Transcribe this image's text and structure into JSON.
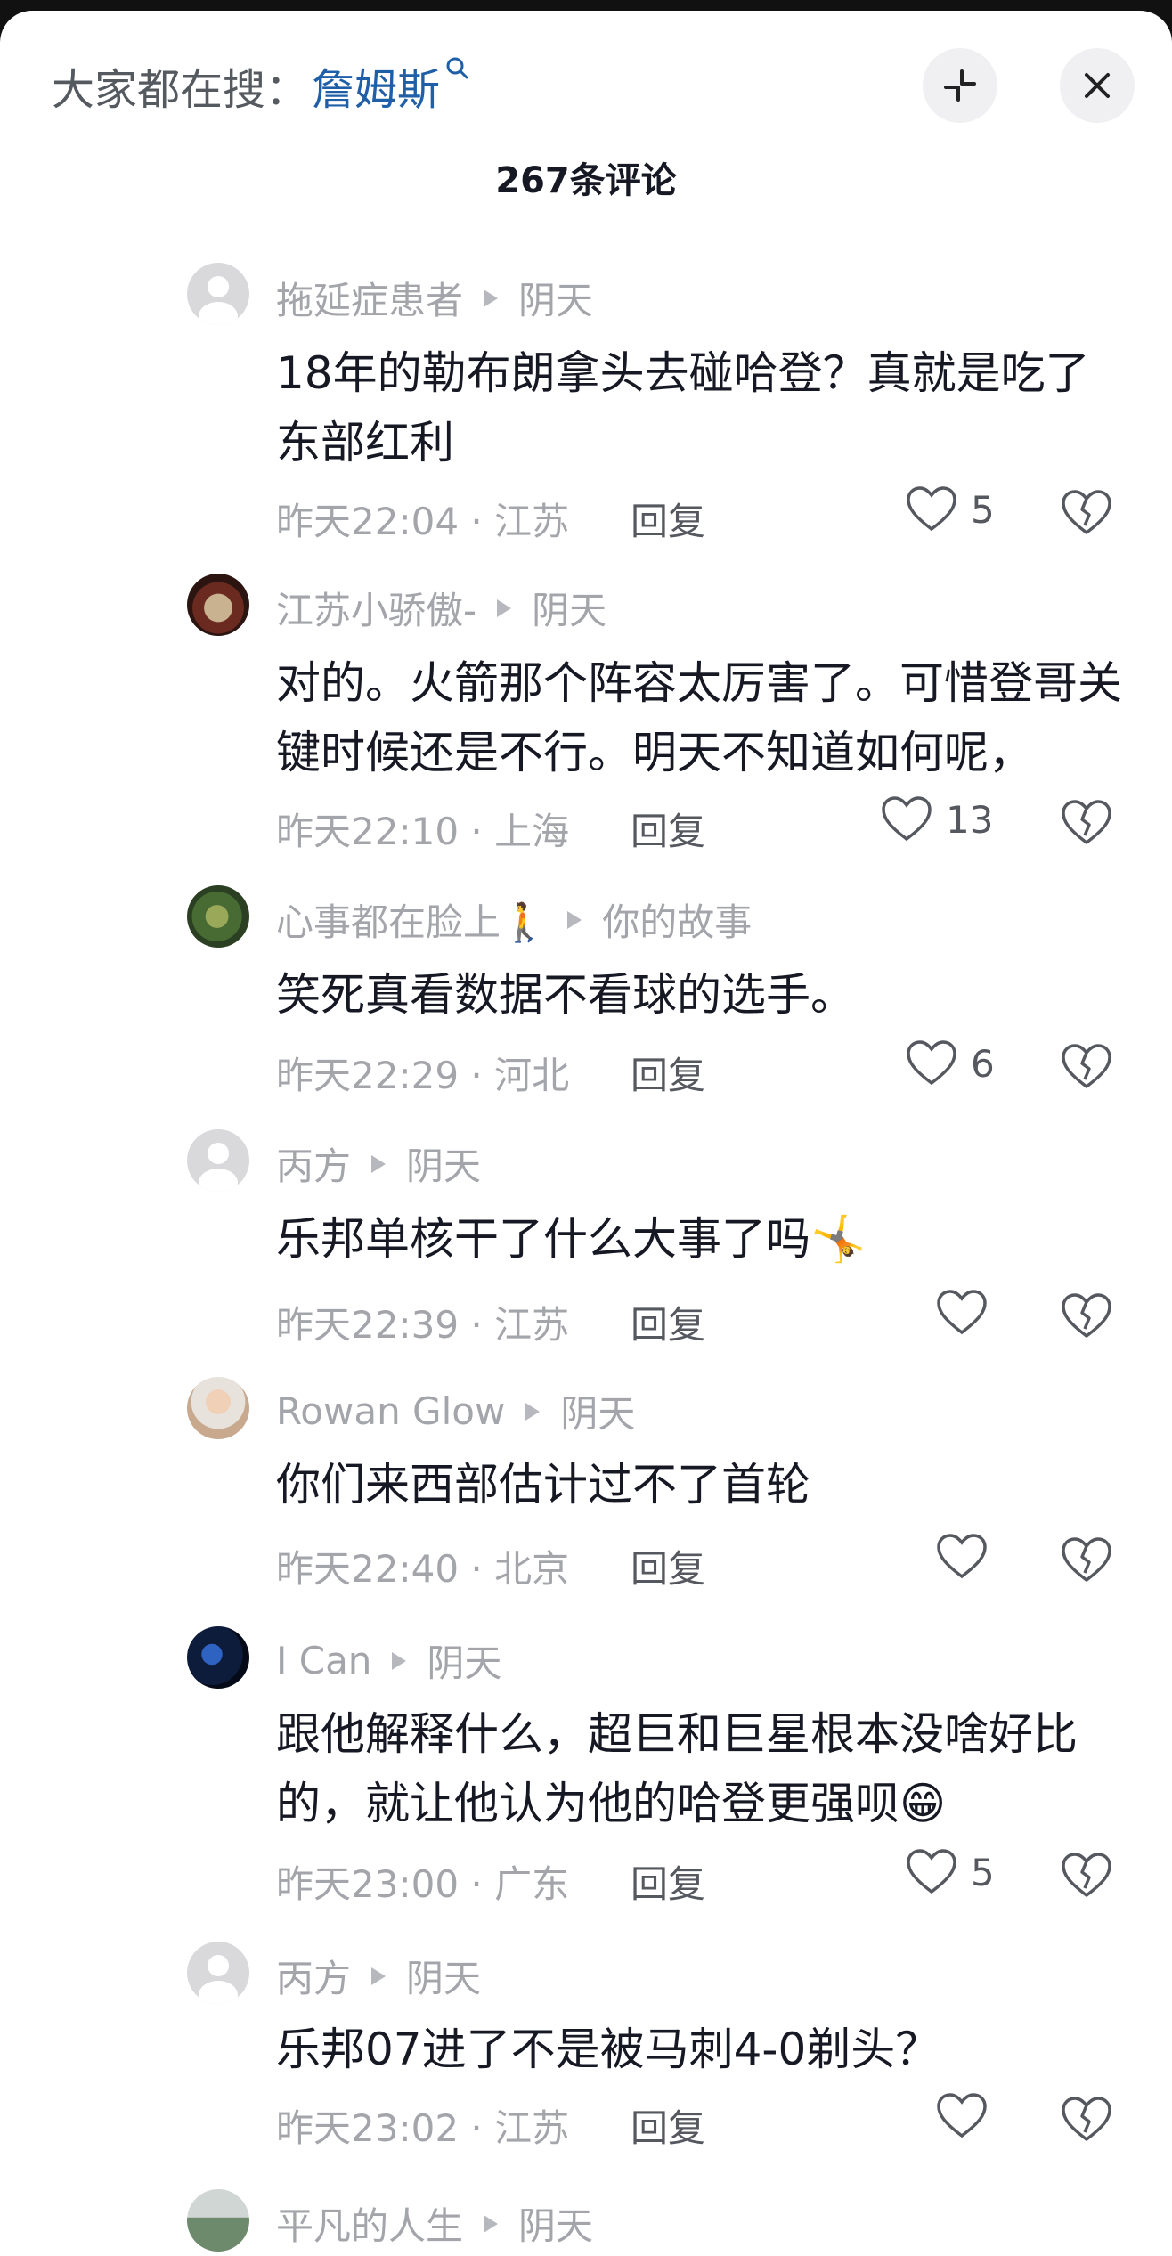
{
  "search": {
    "prefix": "大家都在搜：",
    "term": "詹姆斯"
  },
  "header": {
    "comment_count": "267条评论"
  },
  "comments": [
    {
      "user": "拖延症患者",
      "reply_to": "阴天",
      "text": "18年的勒布朗拿头去碰哈登？真就是吃了东部红利",
      "time": "昨天22:04 · 江苏",
      "reply_label": "回复",
      "likes": "5",
      "avatar": "default"
    },
    {
      "user": "江苏小骄傲-",
      "reply_to": "阴天",
      "text": "对的。火箭那个阵容太厉害了。可惜登哥关键时候还是不行。明天不知道如何呢，",
      "time": "昨天22:10 · 上海",
      "reply_label": "回复",
      "likes": "13",
      "avatar": "photo"
    },
    {
      "user": "心事都在脸上🚶",
      "reply_to": "你的故事",
      "text": "笑死真看数据不看球的选手。",
      "time": "昨天22:29 · 河北",
      "reply_label": "回复",
      "likes": "6",
      "avatar": "photo"
    },
    {
      "user": "丙方",
      "reply_to": "阴天",
      "text": "乐邦单核干了什么大事了吗🤸",
      "time": "昨天22:39 · 江苏",
      "reply_label": "回复",
      "likes": "",
      "avatar": "default"
    },
    {
      "user": "Rowan Glow",
      "reply_to": "阴天",
      "text": "你们来西部估计过不了首轮",
      "time": "昨天22:40 · 北京",
      "reply_label": "回复",
      "likes": "",
      "avatar": "photo"
    },
    {
      "user": "I Can",
      "reply_to": "阴天",
      "text": "跟他解释什么，超巨和巨星根本没啥好比的，就让他认为他的哈登更强呗😁",
      "time": "昨天23:00 · 广东",
      "reply_label": "回复",
      "likes": "5",
      "avatar": "photo"
    },
    {
      "user": "丙方",
      "reply_to": "阴天",
      "text": "乐邦07进了不是被马刺4-0剃头？",
      "time": "昨天23:02 · 江苏",
      "reply_label": "回复",
      "likes": "",
      "avatar": "default"
    },
    {
      "user": "平凡的人生",
      "reply_to": "阴天",
      "text": "",
      "time": "",
      "reply_label": "",
      "likes": "",
      "avatar": "photo"
    }
  ],
  "colors": {
    "text_primary": "#161823",
    "text_secondary": "#a3a5ab",
    "link": "#1f5fa8",
    "button_bg": "#f0f0f2"
  },
  "icons": [
    "search-icon",
    "collapse-icon",
    "close-icon",
    "play-triangle-icon",
    "heart-icon",
    "dislike-heart-icon"
  ]
}
